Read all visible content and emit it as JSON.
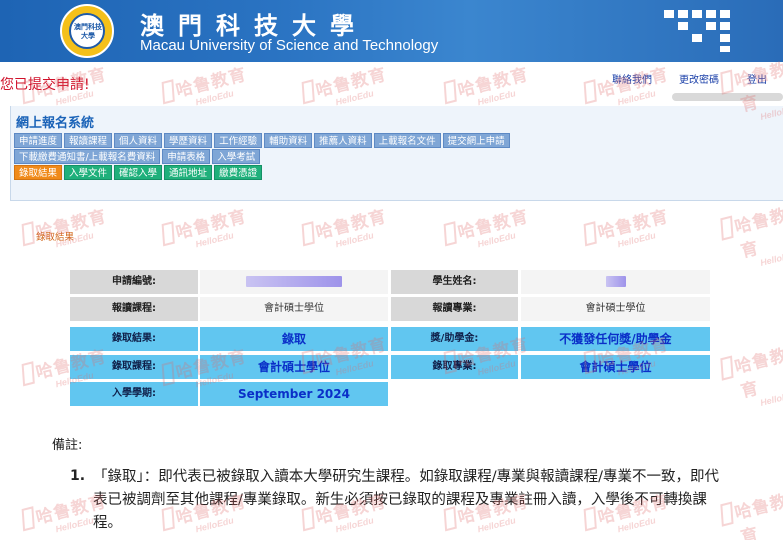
{
  "header": {
    "logo_text": "澳門科技大學",
    "university_cn": "澳門科技大學",
    "university_en": "Macau University of Science and Technology"
  },
  "topbar": {
    "submitted_msg": "您已提交申請!",
    "links": [
      "聯絡我們",
      "更改密碼",
      "登出"
    ]
  },
  "system": {
    "title": "網上報名系統",
    "nav_row1": [
      "申請進度",
      "報讀課程",
      "個人資料",
      "學歷資料",
      "工作經驗",
      "輔助資料",
      "推薦人資料",
      "上載報名文件",
      "提交網上申請"
    ],
    "nav_row2": [
      "下載繳費通知書/上載報名費資料",
      "申請表格",
      "入學考試"
    ],
    "nav_row3": [
      "錄取結果",
      "入學文件",
      "確認入學",
      "通訊地址",
      "繳費憑證"
    ],
    "active_tab": "錄取結果"
  },
  "breadcrumb": "錄取結果",
  "result": {
    "app_no_label": "申請編號:",
    "student_name_label": "學生姓名:",
    "applied_program_label": "報讀課程:",
    "applied_program": "會計碩士學位",
    "applied_major_label": "報讀專業:",
    "applied_major": "會計碩士學位",
    "admission_result_label": "錄取結果:",
    "admission_result": "錄取",
    "scholarship_label": "獎/助學金:",
    "scholarship": "不獲發任何獎/助學金",
    "admitted_program_label": "錄取課程:",
    "admitted_program": "會計碩士學位",
    "admitted_major_label": "錄取專業:",
    "admitted_major": "會計碩士學位",
    "intake_label": "入學學期:",
    "intake": "September 2024"
  },
  "remarks": {
    "title": "備註:",
    "items": [
      {
        "num": "1.",
        "text": "「錄取」：即代表已被錄取入讀本大學研究生課程。如錄取課程/專業與報讀課程/專業不一致，即代表已被調劑至其他課程/專業錄取。新生必須按已錄取的課程及專業註冊入讀，入學後不可轉換課程。"
      }
    ]
  },
  "watermark": {
    "cn": "哈鲁教育",
    "en": "HelloEdu"
  },
  "colors": {
    "header": "#2a73c2",
    "highlight": "#61c6f0",
    "active_tab": "#f08a1a",
    "green_tab": "#1fb07b",
    "alert": "#d0102a"
  }
}
